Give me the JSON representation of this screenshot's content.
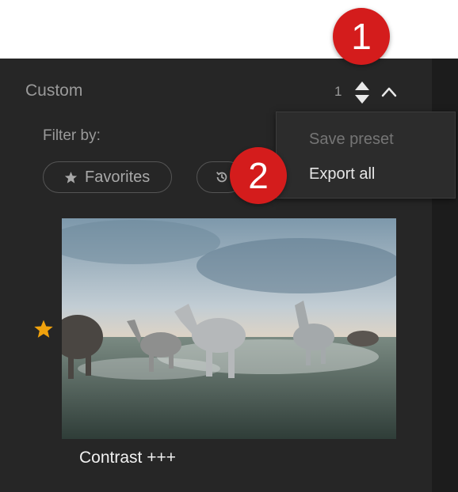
{
  "section": {
    "title": "Custom",
    "count": "1"
  },
  "filter": {
    "label": "Filter by:",
    "favorites_label": "Favorites"
  },
  "menu": {
    "items": [
      "Save preset",
      "Export all"
    ]
  },
  "badges": [
    "1",
    "2"
  ],
  "preset": {
    "name": "Contrast +++",
    "favorite": true
  },
  "icons": {
    "stepper": "up-down-arrows-icon",
    "collapse": "chevron-up-icon",
    "favorites": "star-icon",
    "recent": "history-icon"
  },
  "colors": {
    "panel": "#262626",
    "badge": "#d41c1c",
    "favorite_star": "#f0a20d"
  }
}
